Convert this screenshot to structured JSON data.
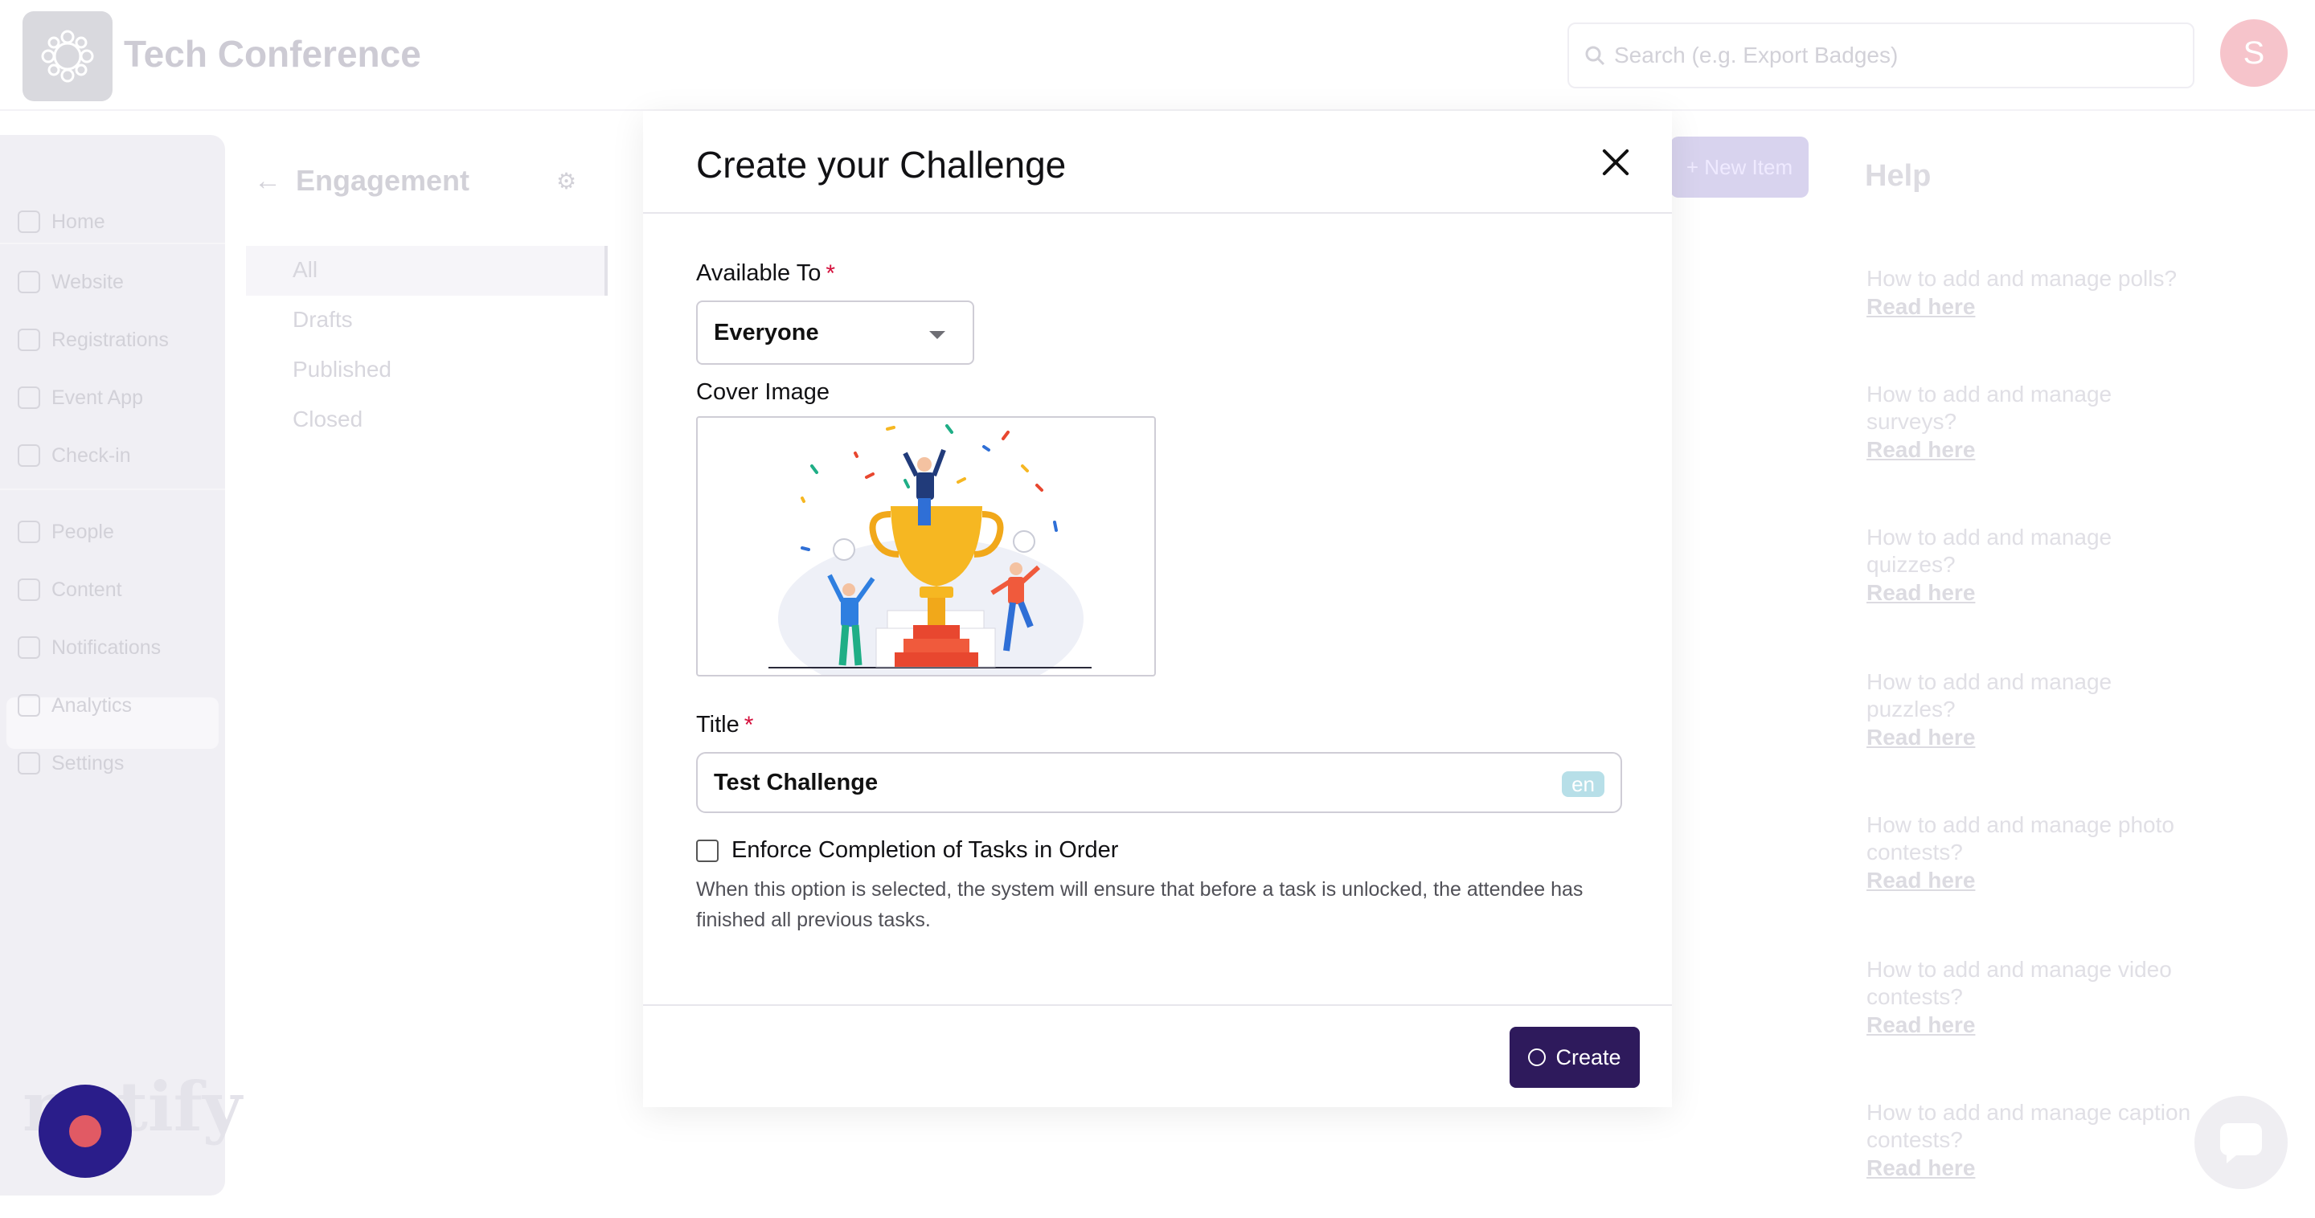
{
  "app": {
    "title": "Tech Conference",
    "search_placeholder": "Search (e.g. Export Badges)",
    "avatar_initial": "S",
    "brand": "notify"
  },
  "sidebar": {
    "items": [
      {
        "label": "Home",
        "icon": "home-icon"
      },
      {
        "label": "Website",
        "icon": "monitor-icon"
      },
      {
        "label": "Registrations",
        "icon": "tag-icon"
      },
      {
        "label": "Event App",
        "icon": "phone-icon"
      },
      {
        "label": "Check-in",
        "icon": "qr-icon"
      },
      {
        "label": "People",
        "icon": "people-icon"
      },
      {
        "label": "Content",
        "icon": "document-icon"
      },
      {
        "label": "Notifications",
        "icon": "bell-icon"
      },
      {
        "label": "Analytics",
        "icon": "chart-icon"
      },
      {
        "label": "Settings",
        "icon": "gear-icon"
      }
    ]
  },
  "engagement": {
    "title": "Engagement",
    "filters": [
      "All",
      "Drafts",
      "Published",
      "Closed"
    ],
    "new_item": "+ New Item"
  },
  "help": {
    "title": "Help",
    "cards": [
      {
        "q": "How to add and manage polls?",
        "link": "Read here"
      },
      {
        "q": "How to add and manage surveys?",
        "link": "Read here"
      },
      {
        "q": "How to add and manage quizzes?",
        "link": "Read here"
      },
      {
        "q": "How to add and manage puzzles?",
        "link": "Read here"
      },
      {
        "q": "How to add and manage photo contests?",
        "link": "Read here"
      },
      {
        "q": "How to add and manage video contests?",
        "link": "Read here"
      },
      {
        "q": "How to add and manage caption contests?",
        "link": "Read here"
      }
    ]
  },
  "modal": {
    "title": "Create your Challenge",
    "available_label": "Available To",
    "available_value": "Everyone",
    "cover_label": "Cover Image",
    "title_label": "Title",
    "title_value": "Test Challenge",
    "lang": "en",
    "checkbox_label": "Enforce Completion of Tasks in Order",
    "checkbox_checked": false,
    "help_text": "When this option is selected, the system will ensure that before a task is unlocked, the attendee has finished all previous tasks.",
    "required_mark": "*",
    "create_label": "Create"
  },
  "colors": {
    "primary_button": "#2e1a5c",
    "required": "#d4103c",
    "fab": "#2a1d8a"
  }
}
